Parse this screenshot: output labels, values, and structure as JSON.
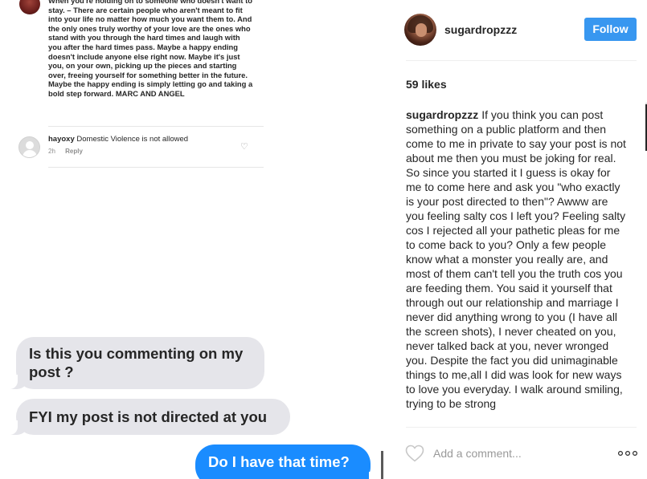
{
  "post_image": {
    "quote_text": "When you're holding on to someone who doesn't want to stay. – There are certain people who aren't meant to fit into your life no matter how much you want them to. And the only ones truly worthy of your love are the ones who stand with you through the hard times and laugh with you after the hard times pass. Maybe a happy ending doesn't include anyone else right now. Maybe it's just you, on your own, picking up the pieces and starting over, freeing yourself for something better in the future. Maybe the happy ending is simply letting go and taking a bold step forward. MARC AND ANGEL",
    "comment": {
      "username": "hayoxy",
      "text": "Domestic Violence is not allowed",
      "time": "2h",
      "reply_label": "Reply",
      "heart_icon": "heart-outline-icon"
    },
    "messages": [
      {
        "text": "Is this you commenting on my post ?",
        "from": "received"
      },
      {
        "text": "FYI my post is not directed at you",
        "from": "received"
      },
      {
        "text": "Do I have that time?",
        "from": "sent"
      }
    ],
    "colors": {
      "received_bubble": "#e5e5ea",
      "sent_bubble": "#1a8cff"
    }
  },
  "post": {
    "username": "sugardropzzz",
    "follow_label": "Follow",
    "likes": "59 likes",
    "caption": "If you think you can post something on a public platform and then come to me in private to say your post is not about me then you must be joking for real. So since you started it I guess is okay for me to come here and ask you \"who exactly is your post directed to then\"? Awww are you feeling salty cos I left you? Feeling salty cos I rejected all your pathetic pleas for me to come back to you? Only a few people know what a monster you really are, and most of them can't tell you the truth cos you are feeding them. You said it yourself that through out our relationship and marriage I never did anything wrong to you (I have all the screen shots), I never cheated on you, never talked back at you, never wronged you. Despite the fact you did unimaginable things to me,all I did was look for new ways to love you everyday. I walk around smiling, trying to be strong",
    "comment_placeholder": "Add a comment...",
    "icons": {
      "like": "heart-icon",
      "more": "more-options-icon"
    },
    "colors": {
      "follow_button": "#3897f0",
      "text": "#262626"
    }
  }
}
